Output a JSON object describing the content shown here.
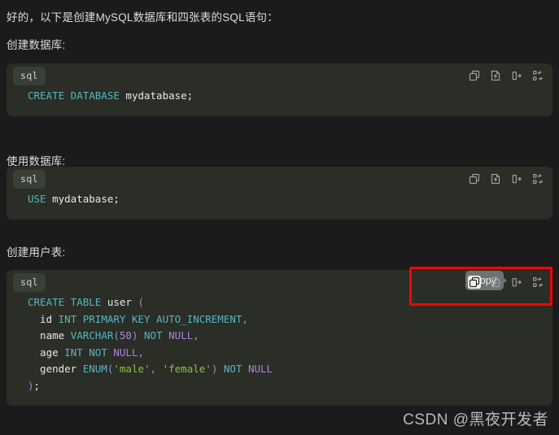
{
  "theme": {
    "page_bg": "#1b1b1b",
    "code_bg": "#2a2e26",
    "badge_bg": "#3a3f36",
    "keyword_color": "#56b6c2",
    "punct_color": "#b07fe0",
    "string_color": "#8fbf4d",
    "text_color": "#dcdcdc",
    "highlight_box_color": "#fb0104",
    "tooltip_bg": "#6e7272"
  },
  "intro": "好的，以下是创建MySQL数据库和四张表的SQL语句：",
  "toolbar": {
    "icons": [
      {
        "name": "copy-icon",
        "label": "Copy"
      },
      {
        "name": "insert-into-file-icon",
        "label": "Insert into file"
      },
      {
        "name": "insert-at-cursor-icon",
        "label": "Insert at cursor"
      },
      {
        "name": "diff-icon",
        "label": "Compare"
      }
    ],
    "tooltip_label": "Copy"
  },
  "sections": [
    {
      "heading": "创建数据库:",
      "language": "sql",
      "tooltip_visible": false,
      "code_lines": [
        [
          {
            "t": "CREATE DATABASE",
            "c": "k"
          },
          {
            "t": " ",
            "c": "w"
          },
          {
            "t": "mydatabase;",
            "c": "w"
          }
        ]
      ]
    },
    {
      "heading": "使用数据库:",
      "language": "sql",
      "tooltip_visible": false,
      "code_lines": [
        [
          {
            "t": "USE",
            "c": "k"
          },
          {
            "t": " ",
            "c": "w"
          },
          {
            "t": "mydatabase;",
            "c": "w"
          }
        ]
      ]
    },
    {
      "heading": "创建用户表:",
      "language": "sql",
      "tooltip_visible": true,
      "code_lines": [
        [
          {
            "t": "CREATE TABLE",
            "c": "k"
          },
          {
            "t": " user ",
            "c": "w"
          },
          {
            "t": "(",
            "c": "p"
          }
        ],
        [
          {
            "t": "  id ",
            "c": "w"
          },
          {
            "t": "INT PRIMARY KEY AUTO_INCREMENT",
            "c": "k"
          },
          {
            "t": ",",
            "c": "p"
          }
        ],
        [
          {
            "t": "  name ",
            "c": "w"
          },
          {
            "t": "VARCHAR",
            "c": "k"
          },
          {
            "t": "(",
            "c": "p"
          },
          {
            "t": "50",
            "c": "n"
          },
          {
            "t": ")",
            "c": "p"
          },
          {
            "t": " ",
            "c": "w"
          },
          {
            "t": "NOT",
            "c": "k"
          },
          {
            "t": " ",
            "c": "w"
          },
          {
            "t": "NULL",
            "c": "p"
          },
          {
            "t": ",",
            "c": "p"
          }
        ],
        [
          {
            "t": "  age ",
            "c": "w"
          },
          {
            "t": "INT",
            "c": "k"
          },
          {
            "t": " ",
            "c": "w"
          },
          {
            "t": "NOT",
            "c": "k"
          },
          {
            "t": " ",
            "c": "w"
          },
          {
            "t": "NULL",
            "c": "p"
          },
          {
            "t": ",",
            "c": "p"
          }
        ],
        [
          {
            "t": "  gender ",
            "c": "w"
          },
          {
            "t": "ENUM",
            "c": "k"
          },
          {
            "t": "(",
            "c": "p"
          },
          {
            "t": "'male'",
            "c": "s"
          },
          {
            "t": ", ",
            "c": "p"
          },
          {
            "t": "'female'",
            "c": "s"
          },
          {
            "t": ")",
            "c": "p"
          },
          {
            "t": " ",
            "c": "w"
          },
          {
            "t": "NOT",
            "c": "k"
          },
          {
            "t": " ",
            "c": "w"
          },
          {
            "t": "NULL",
            "c": "p"
          }
        ],
        [
          {
            "t": ")",
            "c": "p"
          },
          {
            "t": ";",
            "c": "w"
          }
        ]
      ]
    }
  ],
  "watermark": "CSDN @黑夜开发者"
}
